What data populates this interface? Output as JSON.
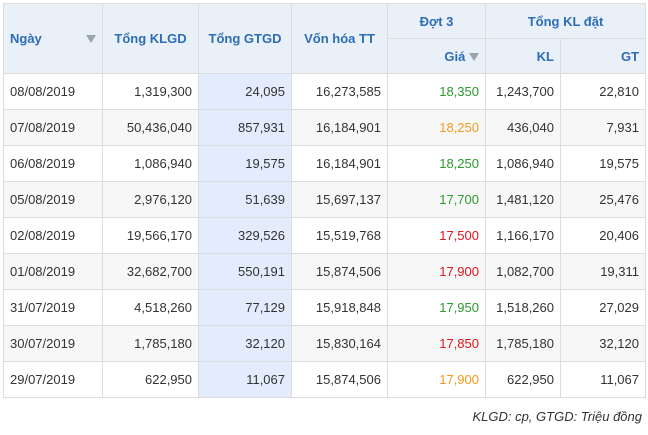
{
  "header": {
    "date": "Ngày",
    "klgd": "Tổng KLGD",
    "gtgd": "Tổng GTGD",
    "von_hoa": "Vốn hóa TT",
    "dot3": "Đợt 3",
    "tong_kl_dat": "Tổng KL đặt",
    "gia": "Giá",
    "kl": "KL",
    "gt": "GT"
  },
  "rows": [
    {
      "date": "08/08/2019",
      "klgd": "1,319,300",
      "gtgd": "24,095",
      "von_hoa": "16,273,585",
      "gia": "18,350",
      "gia_status": "up",
      "kl": "1,243,700",
      "gt": "22,810"
    },
    {
      "date": "07/08/2019",
      "klgd": "50,436,040",
      "gtgd": "857,931",
      "von_hoa": "16,184,901",
      "gia": "18,250",
      "gia_status": "ref",
      "kl": "436,040",
      "gt": "7,931"
    },
    {
      "date": "06/08/2019",
      "klgd": "1,086,940",
      "gtgd": "19,575",
      "von_hoa": "16,184,901",
      "gia": "18,250",
      "gia_status": "up",
      "kl": "1,086,940",
      "gt": "19,575"
    },
    {
      "date": "05/08/2019",
      "klgd": "2,976,120",
      "gtgd": "51,639",
      "von_hoa": "15,697,137",
      "gia": "17,700",
      "gia_status": "up",
      "kl": "1,481,120",
      "gt": "25,476"
    },
    {
      "date": "02/08/2019",
      "klgd": "19,566,170",
      "gtgd": "329,526",
      "von_hoa": "15,519,768",
      "gia": "17,500",
      "gia_status": "down",
      "kl": "1,166,170",
      "gt": "20,406"
    },
    {
      "date": "01/08/2019",
      "klgd": "32,682,700",
      "gtgd": "550,191",
      "von_hoa": "15,874,506",
      "gia": "17,900",
      "gia_status": "down",
      "kl": "1,082,700",
      "gt": "19,311"
    },
    {
      "date": "31/07/2019",
      "klgd": "4,518,260",
      "gtgd": "77,129",
      "von_hoa": "15,918,848",
      "gia": "17,950",
      "gia_status": "up",
      "kl": "1,518,260",
      "gt": "27,029"
    },
    {
      "date": "30/07/2019",
      "klgd": "1,785,180",
      "gtgd": "32,120",
      "von_hoa": "15,830,164",
      "gia": "17,850",
      "gia_status": "down",
      "kl": "1,785,180",
      "gt": "32,120"
    },
    {
      "date": "29/07/2019",
      "klgd": "622,950",
      "gtgd": "11,067",
      "von_hoa": "15,874,506",
      "gia": "17,900",
      "gia_status": "ref",
      "kl": "622,950",
      "gt": "11,067"
    }
  ],
  "colors": {
    "up": "#2a9a2a",
    "down": "#e0151c",
    "ref": "#f59b1a",
    "header_text": "#2d6db7",
    "header_bg": "#e9f0f8",
    "highlight_col": "#e3ecfd"
  },
  "icons": {
    "sort": "sort-down-icon"
  },
  "footnote": "KLGD: cp, GTGD: Triệu đồng"
}
